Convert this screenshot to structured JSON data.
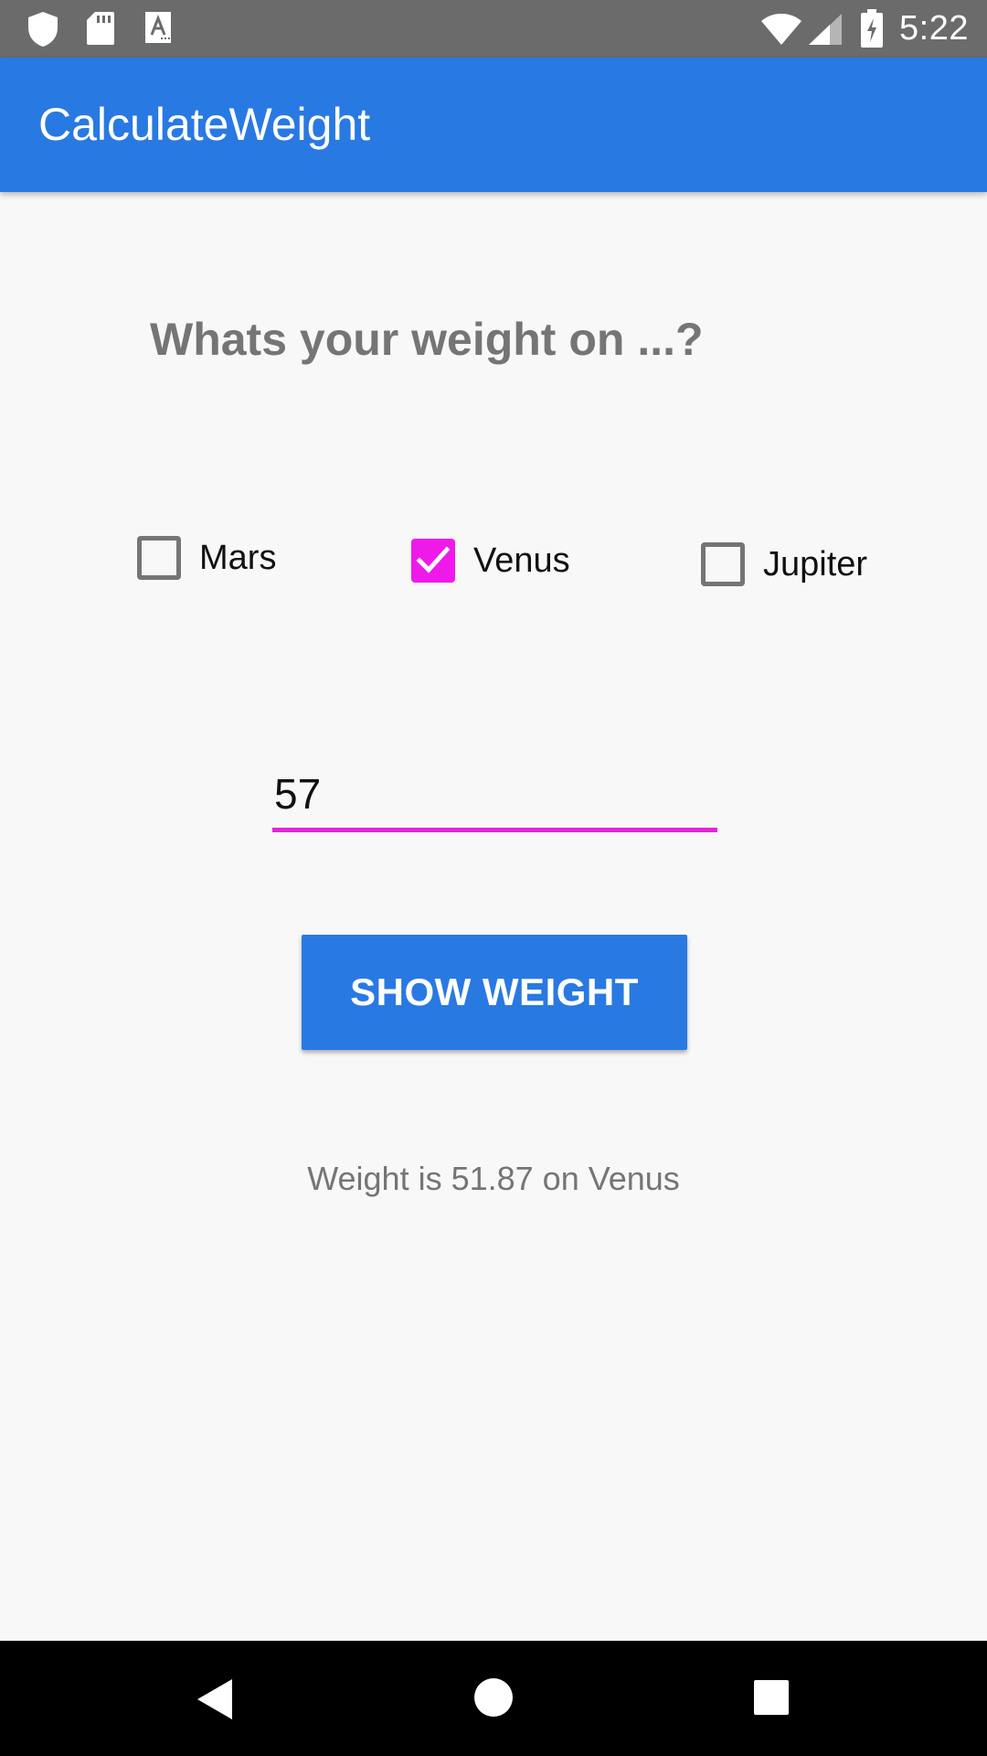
{
  "status_bar": {
    "time": "5:22",
    "left_icons": [
      "shield-icon",
      "sd-card-icon",
      "font-a-icon"
    ],
    "right_icons": [
      "wifi-icon",
      "signal-icon",
      "battery-charging-icon"
    ]
  },
  "app_bar": {
    "title": "CalculateWeight"
  },
  "question": "Whats your weight on ...?",
  "planets": [
    {
      "label": "Mars",
      "checked": false
    },
    {
      "label": "Venus",
      "checked": true
    },
    {
      "label": "Jupiter",
      "checked": false
    }
  ],
  "weight_input": {
    "value": "57"
  },
  "show_button": {
    "label": "SHOW WEIGHT"
  },
  "result": "Weight is 51.87 on Venus",
  "nav_bar": {
    "icons": [
      "back-icon",
      "home-icon",
      "recents-icon"
    ]
  },
  "colors": {
    "status_bar": "#6b6b6b",
    "app_bar": "#2979e2",
    "accent": "#ef1ae9",
    "button": "#2979e2",
    "background": "#f8f8f8"
  }
}
